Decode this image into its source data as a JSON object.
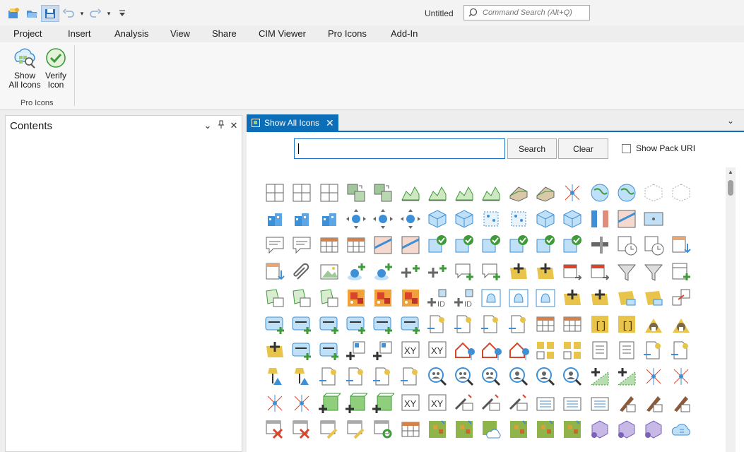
{
  "window": {
    "title": "Untitled"
  },
  "command_search": {
    "placeholder": "Command Search (Alt+Q)"
  },
  "quick_access": [
    "new-project-icon",
    "open-project-icon",
    "save-project-icon",
    "undo-icon",
    "redo-icon",
    "customize-icon"
  ],
  "ribbon_tabs": [
    "Project",
    "Insert",
    "Analysis",
    "View",
    "Share",
    "CIM Viewer",
    "Pro Icons",
    "Add-In"
  ],
  "selected_tab": "Pro Icons",
  "ribbon": {
    "show_all_icons_line1": "Show",
    "show_all_icons_line2": "All Icons",
    "verify_icon_line1": "Verify",
    "verify_icon_line2": "Icon",
    "group_label": "Pro Icons"
  },
  "contents_pane": {
    "title": "Contents"
  },
  "doc_tab": {
    "label": "Show All Icons"
  },
  "search": {
    "value": "",
    "search_label": "Search",
    "clear_label": "Clear",
    "show_pack_uri_label": "Show Pack URI",
    "show_pack_uri_checked": false
  },
  "icon_grid": {
    "rows": [
      [
        "grid",
        "grid",
        "grid",
        "raster",
        "raster",
        "chart",
        "chart",
        "chart",
        "chart",
        "terrain",
        "terrain",
        "network",
        "globe",
        "globe",
        "cube-outline",
        "cube-outline"
      ],
      [
        "buildings",
        "buildings",
        "buildings",
        "move",
        "move",
        "move",
        "cube",
        "cube",
        "voxel",
        "voxel",
        "cube",
        "cube",
        "bars",
        "map",
        "frame"
      ],
      [
        "comment",
        "comment",
        "table",
        "table",
        "map",
        "map",
        "check",
        "check",
        "check",
        "check",
        "check",
        "check",
        "sliders",
        "clock",
        "clock",
        "table-arrow"
      ],
      [
        "table-arrow",
        "attach",
        "image",
        "location-add",
        "location-add",
        "add",
        "add",
        "comment-add",
        "comment-add",
        "add-polygon",
        "add-polygon",
        "calendar",
        "calendar",
        "filter",
        "filter",
        "table-add"
      ],
      [
        "polygon-table",
        "polygon-table",
        "polygon-table",
        "heatmap",
        "heatmap",
        "heatmap",
        "add-id",
        "add-id",
        "bell",
        "bell",
        "bell",
        "add-polygon",
        "add-polygon",
        "polygon",
        "polygon",
        "link"
      ],
      [
        "layer",
        "layer",
        "layer",
        "layer",
        "layer",
        "layer",
        "doc",
        "doc",
        "doc",
        "doc",
        "table",
        "table",
        "bracket",
        "bracket",
        "house",
        "house"
      ],
      [
        "add-polygon",
        "layer",
        "layer",
        "grid-add",
        "grid-add",
        "xy",
        "xy",
        "house-pin",
        "house-pin",
        "house-pin",
        "squares",
        "squares",
        "notes",
        "notes",
        "doc",
        "doc"
      ],
      [
        "lamp",
        "lamp",
        "doc",
        "doc",
        "doc",
        "doc",
        "search-people",
        "search-people",
        "search-people",
        "search-person",
        "search-person",
        "search-person",
        "dotted",
        "dotted",
        "network",
        "network"
      ],
      [
        "network",
        "network",
        "cube-add",
        "cube-add",
        "cube-add",
        "xy",
        "xy",
        "label",
        "label",
        "label",
        "list",
        "list",
        "list",
        "pen",
        "pen",
        "pen"
      ],
      [
        "table-x",
        "table-x",
        "table-pen",
        "table-pen",
        "table-o",
        "table",
        "grid-color",
        "grid-color",
        "grid-cloud",
        "grid-color",
        "grid-color",
        "grid-color",
        "hex",
        "hex",
        "hex",
        "cloud"
      ]
    ]
  },
  "colors": {
    "accent": "#0d6eb8",
    "tab_underline": "#2e6fb5",
    "icon_blue": "#3d8fd6",
    "icon_green": "#3f9a3a",
    "icon_yellow": "#e9c44a"
  }
}
